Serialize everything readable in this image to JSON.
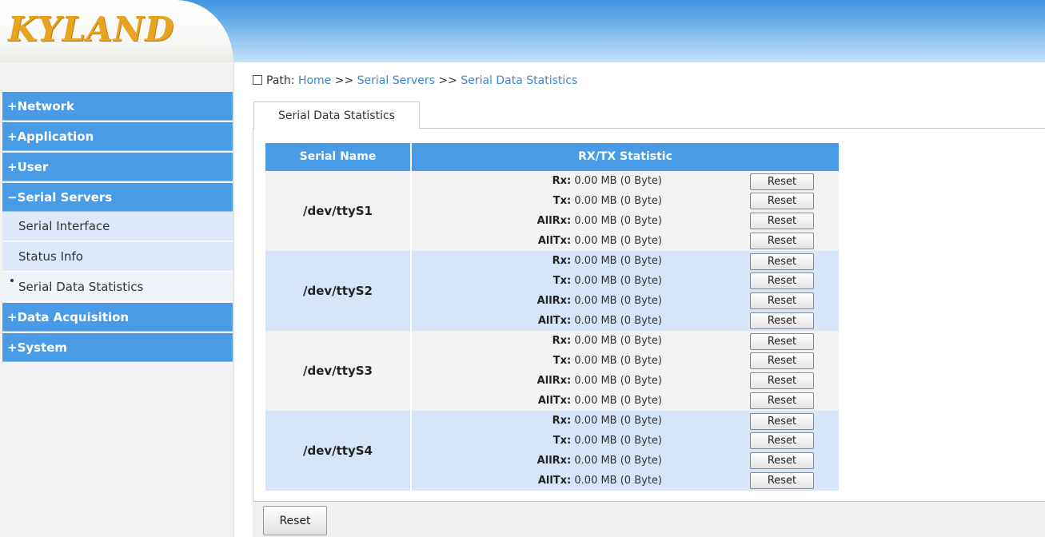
{
  "header": {
    "logo_text": "KYLAND"
  },
  "sidebar": {
    "items": [
      {
        "label": "+Network"
      },
      {
        "label": "+Application"
      },
      {
        "label": "+User"
      },
      {
        "label": "−Serial Servers"
      },
      {
        "label": "Serial Interface"
      },
      {
        "label": "Status Info"
      },
      {
        "label": "Serial Data Statistics"
      },
      {
        "label": "+Data Acquisition"
      },
      {
        "label": "+System"
      }
    ]
  },
  "path": {
    "prefix": "Path:",
    "home": "Home",
    "sep1": ">>",
    "serial_servers": "Serial Servers",
    "sep2": ">>",
    "current": "Serial Data Statistics"
  },
  "tab": {
    "label": "Serial Data Statistics"
  },
  "table": {
    "headers": [
      "Serial Name",
      "RX/TX Statistic"
    ],
    "rows": [
      {
        "name": "/dev/ttyS1",
        "stats": [
          {
            "label": "Rx:",
            "value": "0.00 MB (0 Byte)"
          },
          {
            "label": "Tx:",
            "value": "0.00 MB (0 Byte)"
          },
          {
            "label": "AllRx:",
            "value": "0.00 MB (0 Byte)"
          },
          {
            "label": "AllTx:",
            "value": "0.00 MB (0 Byte)"
          }
        ]
      },
      {
        "name": "/dev/ttyS2",
        "stats": [
          {
            "label": "Rx:",
            "value": "0.00 MB (0 Byte)"
          },
          {
            "label": "Tx:",
            "value": "0.00 MB (0 Byte)"
          },
          {
            "label": "AllRx:",
            "value": "0.00 MB (0 Byte)"
          },
          {
            "label": "AllTx:",
            "value": "0.00 MB (0 Byte)"
          }
        ]
      },
      {
        "name": "/dev/ttyS3",
        "stats": [
          {
            "label": "Rx:",
            "value": "0.00 MB (0 Byte)"
          },
          {
            "label": "Tx:",
            "value": "0.00 MB (0 Byte)"
          },
          {
            "label": "AllRx:",
            "value": "0.00 MB (0 Byte)"
          },
          {
            "label": "AllTx:",
            "value": "0.00 MB (0 Byte)"
          }
        ]
      },
      {
        "name": "/dev/ttyS4",
        "stats": [
          {
            "label": "Rx:",
            "value": "0.00 MB (0 Byte)"
          },
          {
            "label": "Tx:",
            "value": "0.00 MB (0 Byte)"
          },
          {
            "label": "AllRx:",
            "value": "0.00 MB (0 Byte)"
          },
          {
            "label": "AllTx:",
            "value": "0.00 MB (0 Byte)"
          }
        ]
      }
    ],
    "reset_label": "Reset"
  },
  "footer": {
    "reset_all_label": "Reset"
  },
  "colors": {
    "menu_blue": "#4a9be6",
    "logo_orange": "#e8a31f",
    "row_alt": "#d6e6f8"
  }
}
